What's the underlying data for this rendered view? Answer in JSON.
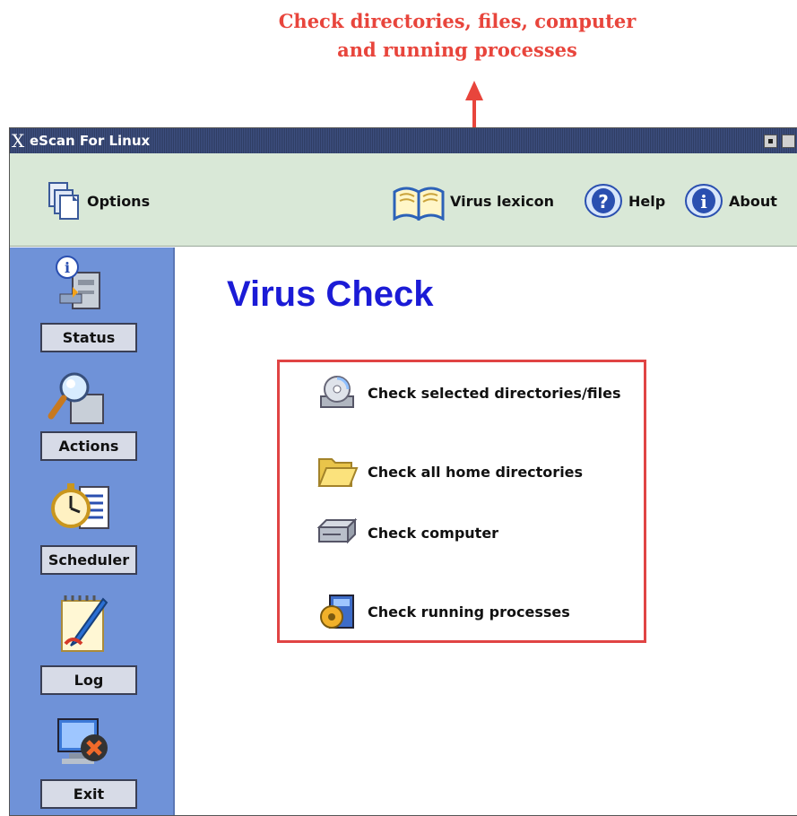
{
  "annotation": {
    "callout_line1": "Check directories, files, computer",
    "callout_line2": "and running processes",
    "color": "#e8453c"
  },
  "window": {
    "title": "eScan For Linux",
    "title_icon": "x-logo-icon"
  },
  "toolbar": {
    "options_label": "Options",
    "lexicon_label": "Virus lexicon",
    "help_label": "Help",
    "about_label": "About"
  },
  "sidebar": {
    "items": [
      {
        "label": "Status",
        "icon": "status-info-icon"
      },
      {
        "label": "Actions",
        "icon": "search-magnifier-icon"
      },
      {
        "label": "Scheduler",
        "icon": "clock-schedule-icon"
      },
      {
        "label": "Log",
        "icon": "notepad-pencil-icon"
      },
      {
        "label": "Exit",
        "icon": "exit-monitor-icon"
      }
    ],
    "color": "#6f92d8"
  },
  "main": {
    "title": "Virus Check",
    "title_color": "#1b1bd6",
    "options": [
      {
        "label": "Check selected directories/files",
        "icon": "cd-drive-icon"
      },
      {
        "label": "Check all home directories",
        "icon": "folder-open-icon"
      },
      {
        "label": "Check computer",
        "icon": "hard-drive-icon"
      },
      {
        "label": "Check running processes",
        "icon": "process-shield-icon"
      }
    ]
  }
}
